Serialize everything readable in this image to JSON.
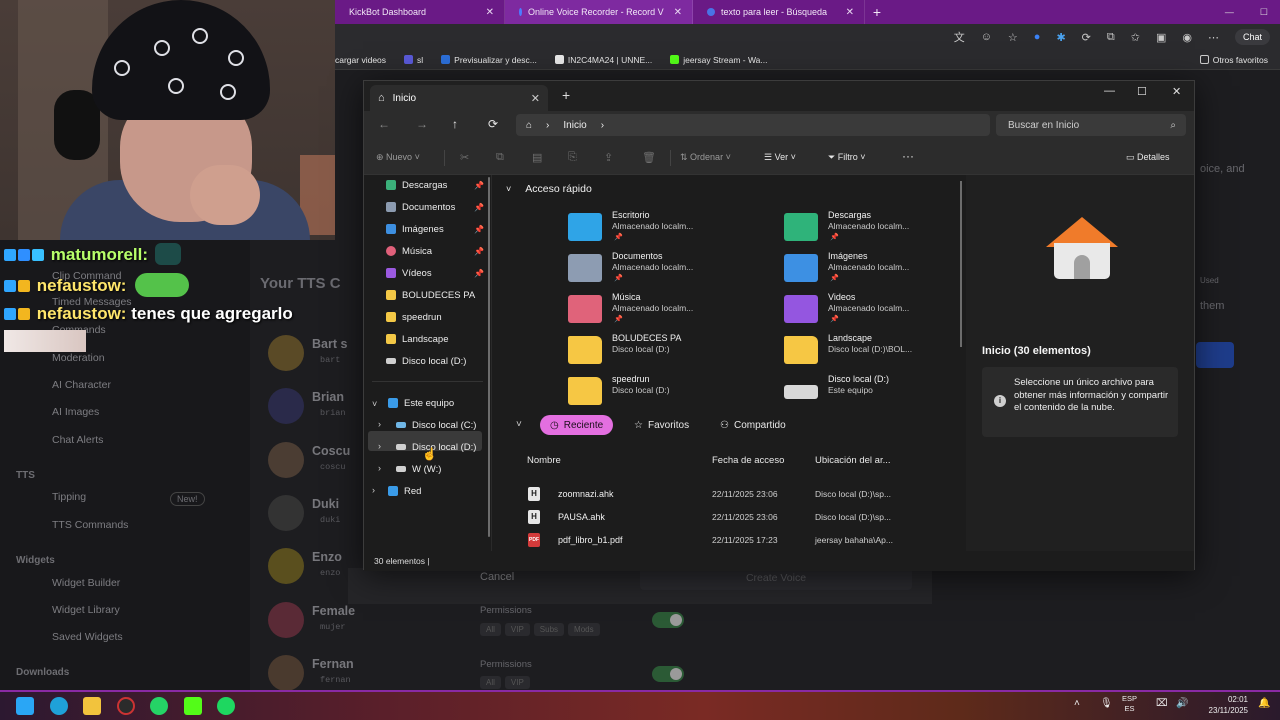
{
  "browser": {
    "tabs": [
      {
        "label": "KickBot Dashboard",
        "active": false
      },
      {
        "label": "Online Voice Recorder - Record V",
        "active": true
      },
      {
        "label": "texto para leer - Búsqueda",
        "active": false
      }
    ],
    "new_tab": "+",
    "chat_label": "Chat",
    "bookmarks": [
      "cargar videos",
      "sl",
      "Previsualizar y desc...",
      "IN2C4MA24 | UNNE...",
      "jeersay Stream - Wa..."
    ],
    "other_bookmarks": "Otros favoritos"
  },
  "webapp": {
    "sidebar_items": [
      "Clip Command",
      "Timed Messages",
      "Commands",
      "Moderation",
      "AI Character",
      "AI Images",
      "Chat Alerts",
      "Tipping",
      "TTS Commands",
      "Widget Builder",
      "Widget Library",
      "Saved Widgets"
    ],
    "sections": [
      "TTS",
      "Widgets",
      "Downloads"
    ],
    "new_badge": "New!",
    "list_title": "Your TTS C",
    "voices": [
      {
        "name": "Bart s",
        "sub": "bart"
      },
      {
        "name": "Brian",
        "sub": "brian"
      },
      {
        "name": "Coscu",
        "sub": "coscu"
      },
      {
        "name": "Duki",
        "sub": "duki"
      },
      {
        "name": "Enzo",
        "sub": "enzo"
      },
      {
        "name": "Female",
        "sub": "mujer"
      },
      {
        "name": "Fernan",
        "sub": "fernan"
      }
    ],
    "permissions_label": "Permissions",
    "perm_chips": [
      "All",
      "VIP",
      "Subs",
      "Mods"
    ],
    "cancel_label": "Cancel",
    "create_label": "Create Voice",
    "right_texts": [
      "oice, and",
      "Used",
      "them"
    ]
  },
  "chat": [
    {
      "user": "matumorell:",
      "message": ""
    },
    {
      "user": "nefaustow:",
      "message": ""
    },
    {
      "user": "nefaustow:",
      "message": "tenes que agregarlo"
    }
  ],
  "explorer": {
    "tab_title": "Inicio",
    "address": "Inicio",
    "search_placeholder": "Buscar en Inicio",
    "toolbar": {
      "new_label": "Nuevo",
      "sort_label": "Ordenar",
      "view_label": "Ver",
      "filter_label": "Filtro",
      "more_label": "···",
      "details_label": "Detalles"
    },
    "nav_pane": [
      {
        "label": "Descargas",
        "pinned": true,
        "color": "#3bb07a"
      },
      {
        "label": "Documentos",
        "pinned": true,
        "color": "#8c9bb0"
      },
      {
        "label": "Imágenes",
        "pinned": true,
        "color": "#3d8fe0"
      },
      {
        "label": "Música",
        "pinned": true,
        "color": "#e0607a"
      },
      {
        "label": "Vídeos",
        "pinned": true,
        "color": "#9b5ae0"
      },
      {
        "label": "BOLUDECES PA",
        "pinned": false,
        "color": "#f3c846"
      },
      {
        "label": "speedrun",
        "pinned": false,
        "color": "#f3c846"
      },
      {
        "label": "Landscape",
        "pinned": false,
        "color": "#f3c846"
      },
      {
        "label": "Disco local (D:)",
        "pinned": false,
        "color": "#cfcfcf"
      }
    ],
    "tree": {
      "this_pc": "Este equipo",
      "drives": [
        "Disco local (C:)",
        "Disco local (D:)",
        "W (W:)"
      ],
      "network": "Red"
    },
    "quick_access_title": "Acceso rápido",
    "quick_access": [
      {
        "name": "Escritorio",
        "sub": "Almacenado localm...",
        "pinned": true,
        "color": "#2fa4e7"
      },
      {
        "name": "Descargas",
        "sub": "Almacenado localm...",
        "pinned": true,
        "color": "#2fb37a"
      },
      {
        "name": "Documentos",
        "sub": "Almacenado localm...",
        "pinned": true,
        "color": "#8d9cb2"
      },
      {
        "name": "Imágenes",
        "sub": "Almacenado localm...",
        "pinned": true,
        "color": "#3d90e3"
      },
      {
        "name": "Música",
        "sub": "Almacenado localm...",
        "pinned": true,
        "color": "#e0637a"
      },
      {
        "name": "Videos",
        "sub": "Almacenado localm...",
        "pinned": true,
        "color": "#9456e0"
      },
      {
        "name": "BOLUDECES PA",
        "sub": "Disco local (D:)",
        "pinned": false,
        "color": "#f6c744"
      },
      {
        "name": "Landscape",
        "sub": "Disco local (D:)\\BOL...",
        "pinned": false,
        "color": "#f6c744"
      },
      {
        "name": "speedrun",
        "sub": "Disco local (D:)",
        "pinned": false,
        "color": "#f6c744"
      },
      {
        "name": "Disco local (D:)",
        "sub": "Este equipo",
        "pinned": false,
        "color": "#d8d8d8"
      }
    ],
    "filters": {
      "recent": "Reciente",
      "favorites": "Favoritos",
      "shared": "Compartido"
    },
    "columns": {
      "name": "Nombre",
      "date": "Fecha de acceso",
      "location": "Ubicación del ar..."
    },
    "files": [
      {
        "name": "zoomnazi.ahk",
        "date": "22/11/2025 23:06",
        "location": "Disco local (D:)\\sp...",
        "type": "ahk"
      },
      {
        "name": "PAUSA.ahk",
        "date": "22/11/2025 23:06",
        "location": "Disco local (D:)\\sp...",
        "type": "ahk"
      },
      {
        "name": "pdf_libro_b1.pdf",
        "date": "22/11/2025 17:23",
        "location": "jeersay bahaha\\Ap...",
        "type": "pdf"
      }
    ],
    "details": {
      "title": "Inicio (30 elementos)",
      "info": "Seleccione un único archivo para obtener más información y compartir el contenido de la nube."
    },
    "status": "30 elementos"
  },
  "taskbar": {
    "lang": "ESP",
    "region": "ES",
    "time": "02:01",
    "date": "23/11/2025"
  }
}
